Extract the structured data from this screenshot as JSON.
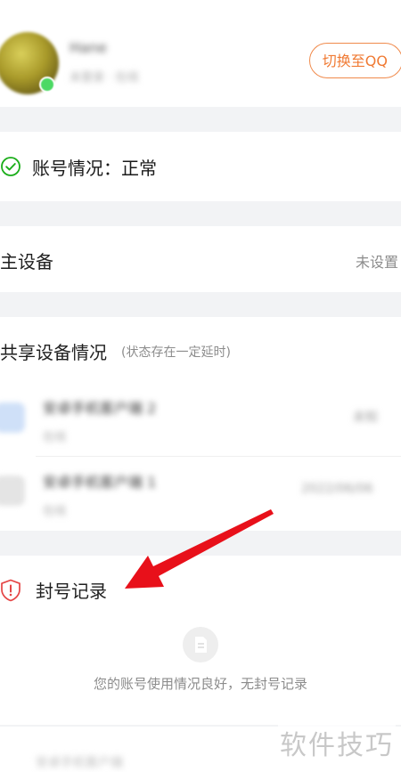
{
  "account": {
    "name": "Hane",
    "meta": "未登录 · 在线",
    "switch_button": "切换至QQ"
  },
  "status": {
    "label": "账号情况：正常",
    "icon": "check-circle-icon",
    "color": "#1aad19"
  },
  "main_device": {
    "label": "主设备",
    "value": "未设置"
  },
  "shared_devices": {
    "title": "共享设备情况",
    "note": "(状态存在一定延时)",
    "items": [
      {
        "name": "安卓手机客户端 2",
        "sub": "在线",
        "time": "未知"
      },
      {
        "name": "安卓手机客户端 1",
        "sub": "在线",
        "time": "2022/06/06"
      }
    ]
  },
  "ban_record": {
    "title": "封号记录",
    "icon": "shield-alert-icon",
    "icon_color": "#e54545",
    "empty_text": "您的账号使用情况良好，无封号记录"
  },
  "bottom": {
    "blurred_text": "安卓手机客户端"
  },
  "watermark": "软件技巧",
  "colors": {
    "accent": "#f07a33",
    "annotation_arrow": "#e8101a"
  }
}
